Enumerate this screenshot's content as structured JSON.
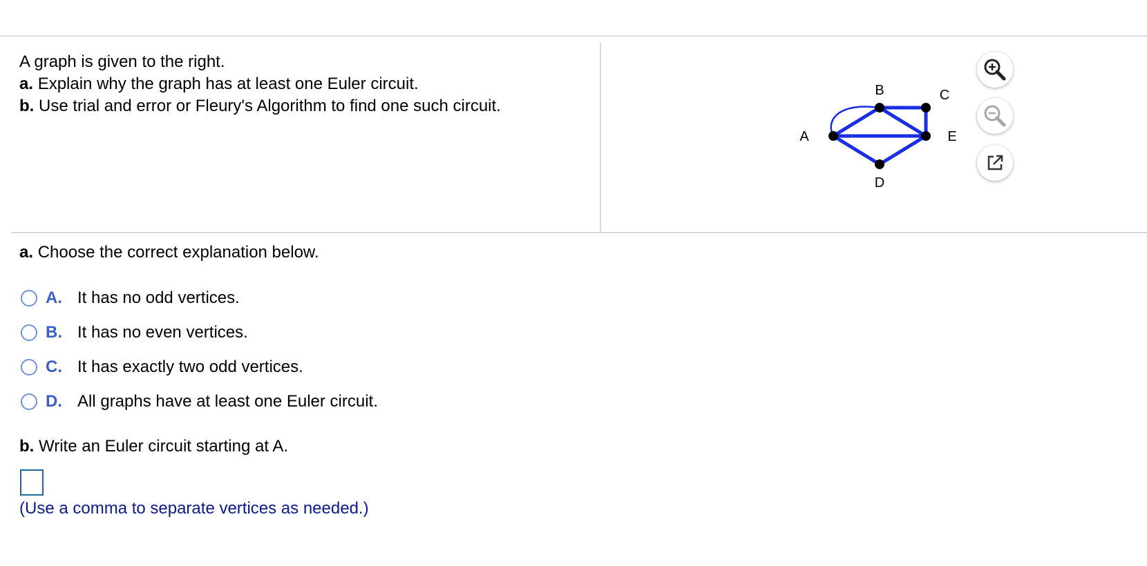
{
  "question": {
    "intro": "A graph is given to the right.",
    "part_a_label": "a.",
    "part_a_text": "Explain why the graph has at least one Euler circuit.",
    "part_b_label": "b.",
    "part_b_text": "Use trial and error or Fleury's Algorithm to find one such circuit."
  },
  "graph": {
    "vertices": [
      "A",
      "B",
      "C",
      "D",
      "E"
    ],
    "edges": [
      [
        "A",
        "B"
      ],
      [
        "A",
        "B"
      ],
      [
        "A",
        "E"
      ],
      [
        "A",
        "D"
      ],
      [
        "B",
        "C"
      ],
      [
        "B",
        "E"
      ],
      [
        "C",
        "E"
      ],
      [
        "D",
        "E"
      ]
    ],
    "edge_color": "#1a2ee6"
  },
  "tools": {
    "zoom_in": "zoom-in-icon",
    "zoom_out": "zoom-out-icon",
    "popout": "popout-icon"
  },
  "part_a": {
    "label": "a.",
    "prompt": "Choose the correct explanation below.",
    "options": [
      {
        "letter": "A.",
        "text": "It has no odd vertices."
      },
      {
        "letter": "B.",
        "text": "It has no even vertices."
      },
      {
        "letter": "C.",
        "text": "It has exactly two odd vertices."
      },
      {
        "letter": "D.",
        "text": "All graphs have at least one Euler circuit."
      }
    ]
  },
  "part_b": {
    "label": "b.",
    "prompt": "Write an Euler circuit starting at A.",
    "answer_value": "",
    "hint": "(Use a comma to separate vertices as needed.)"
  }
}
